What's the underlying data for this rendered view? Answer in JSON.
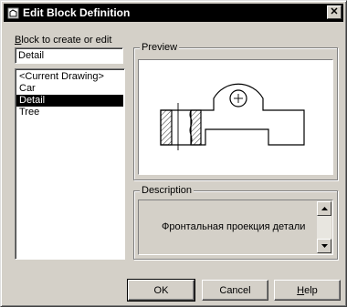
{
  "window": {
    "title": "Edit Block Definition",
    "close_glyph": "✕"
  },
  "block_section": {
    "label_prefix": "B",
    "label_rest": "lock to create or edit",
    "name_value": "Detail"
  },
  "block_list": [
    {
      "label": "<Current Drawing>",
      "selected": false
    },
    {
      "label": "Car",
      "selected": false
    },
    {
      "label": "Detail",
      "selected": true
    },
    {
      "label": "Tree",
      "selected": false
    }
  ],
  "preview": {
    "title": "Preview"
  },
  "description": {
    "title": "Description",
    "text": "Фронтальная проекция детали"
  },
  "buttons": {
    "ok": "OK",
    "cancel": "Cancel",
    "help_prefix": "H",
    "help_rest": "elp"
  },
  "icons": {
    "title": "block-icon",
    "close": "close-icon",
    "scroll_up": "arrow-up-icon",
    "scroll_down": "arrow-down-icon"
  }
}
